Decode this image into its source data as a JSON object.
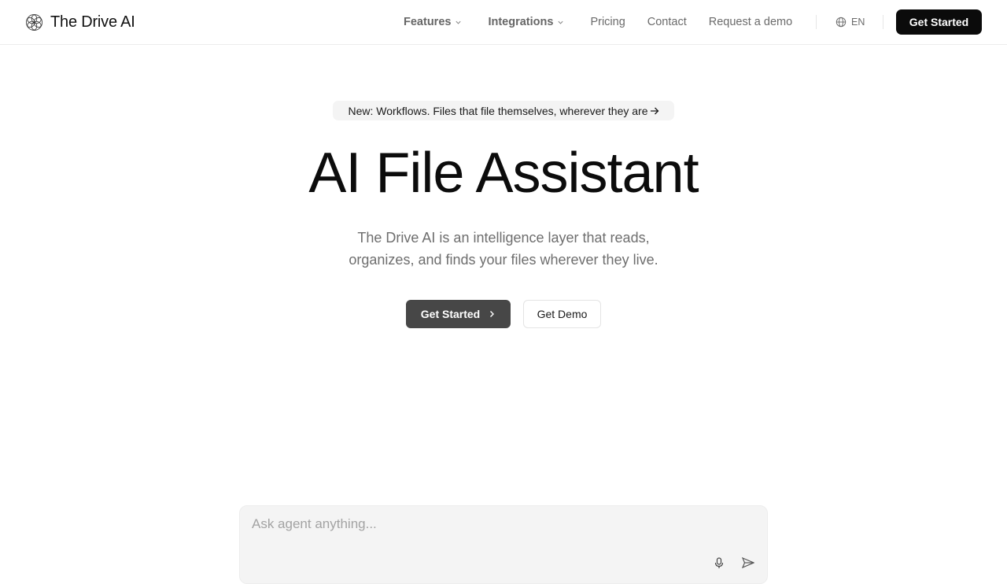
{
  "brand": {
    "name": "The Drive AI"
  },
  "nav": {
    "links": [
      {
        "label": "Features",
        "dropdown": true
      },
      {
        "label": "Integrations",
        "dropdown": true
      },
      {
        "label": "Pricing",
        "dropdown": false
      },
      {
        "label": "Contact",
        "dropdown": false
      },
      {
        "label": "Request a demo",
        "dropdown": false
      }
    ],
    "language": "EN",
    "cta_label": "Get Started"
  },
  "hero": {
    "announcement": "New: Workflows. Files that file themselves, wherever they are",
    "title": "AI File Assistant",
    "subtitle_line1": "The Drive AI is an intelligence layer that reads,",
    "subtitle_line2": "organizes, and finds your files wherever they live.",
    "primary_label": "Get Started",
    "secondary_label": "Get Demo"
  },
  "chat": {
    "placeholder": "Ask agent anything..."
  },
  "icons": {
    "logo": "geometric-flower-icon",
    "dropdown": "chevron-down-icon",
    "language": "globe-icon",
    "announce": "arrow-right-icon",
    "cta": "chevron-right-icon",
    "mic": "microphone-icon",
    "send": "send-icon"
  },
  "colors": {
    "primary_dark": "#0b0b0b",
    "button_gray": "#474747",
    "muted_text": "#6b6b6b",
    "chat_bg": "#f4f4f4"
  }
}
